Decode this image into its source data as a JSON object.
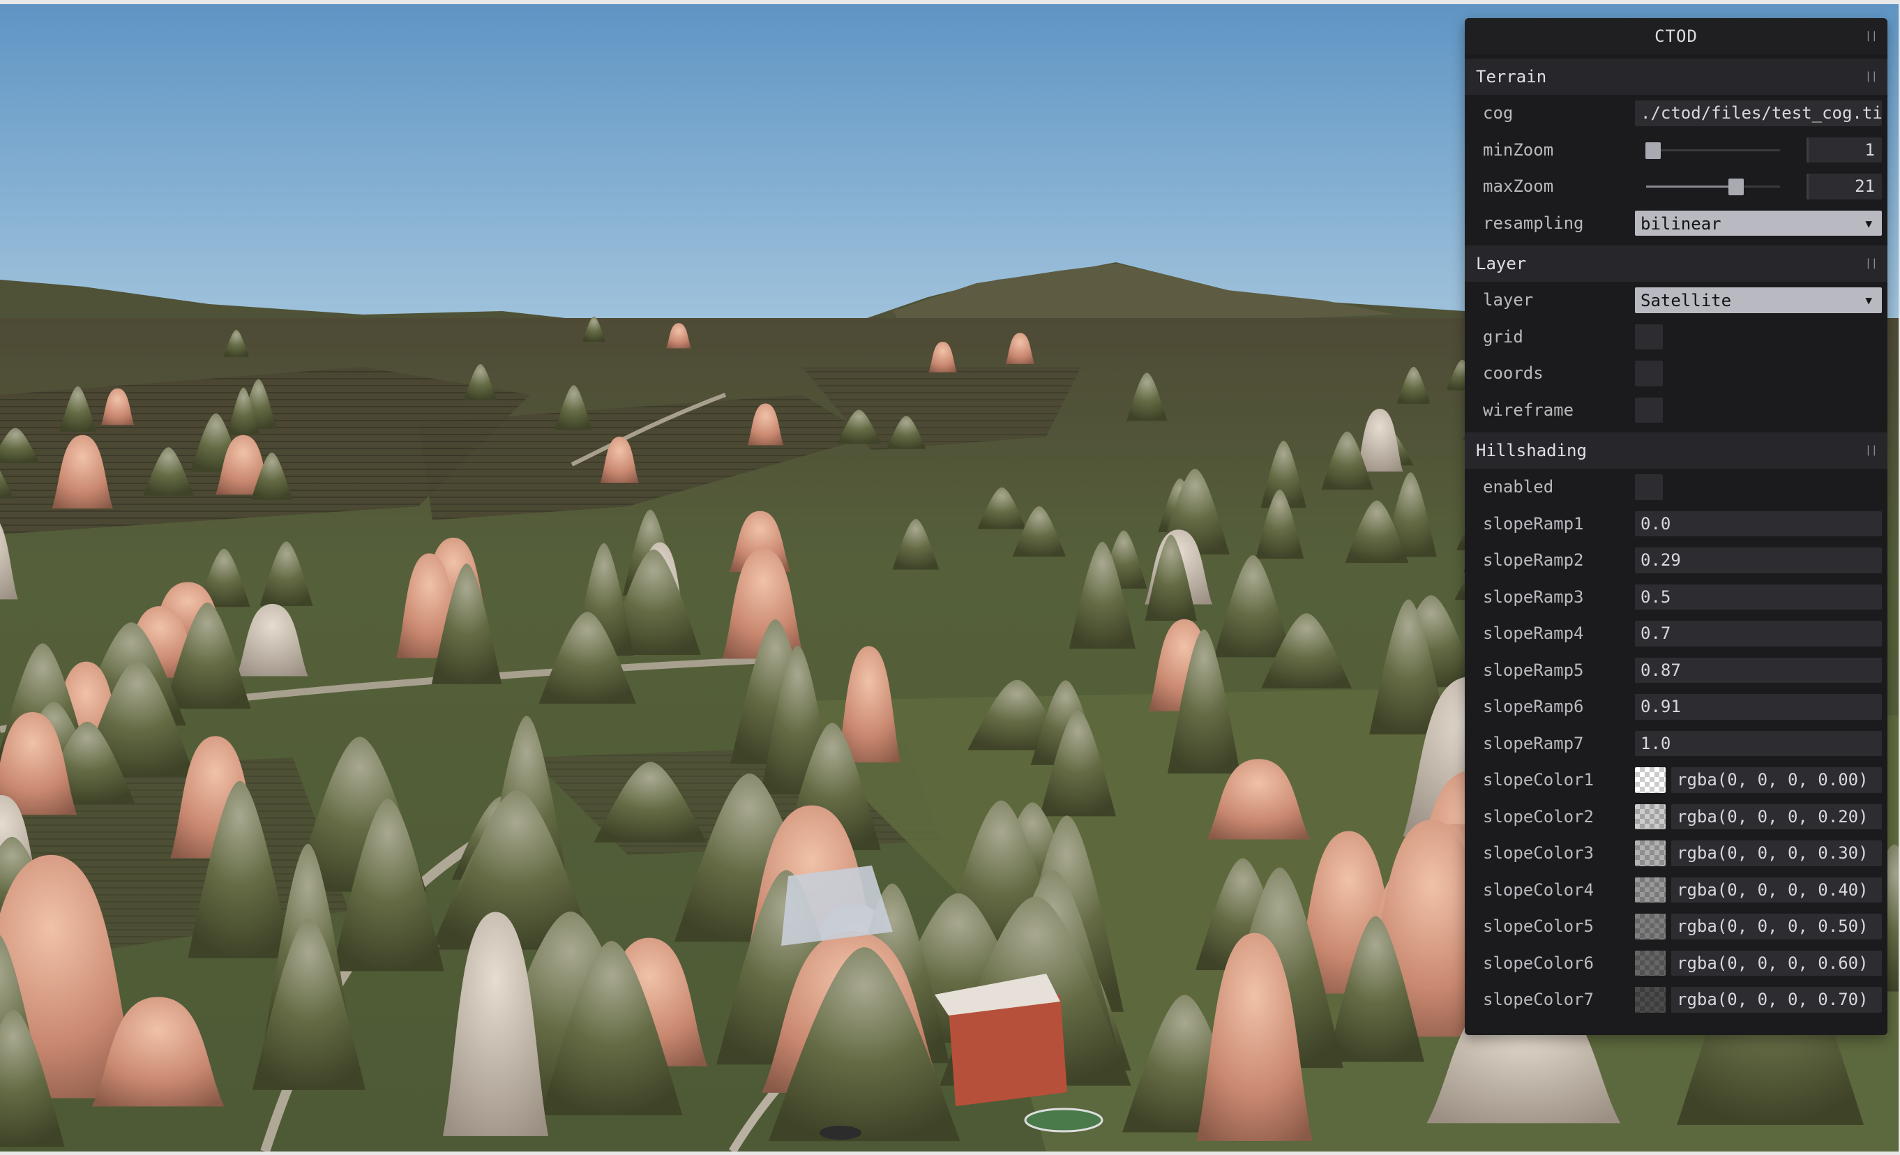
{
  "panel": {
    "title": "CTOD",
    "terrain": {
      "title": "Terrain",
      "cog_label": "cog",
      "cog_value": "./ctod/files/test_cog.tif",
      "minzoom_label": "minZoom",
      "minzoom_value": "1",
      "minzoom_level": 0.05,
      "maxzoom_label": "maxZoom",
      "maxzoom_value": "21",
      "maxzoom_level": 0.67,
      "resampling_label": "resampling",
      "resampling_value": "bilinear"
    },
    "layer": {
      "title": "Layer",
      "layer_label": "layer",
      "layer_value": "Satellite",
      "grid_label": "grid",
      "coords_label": "coords",
      "wireframe_label": "wireframe"
    },
    "hillshading": {
      "title": "Hillshading",
      "enabled_label": "enabled",
      "ramps": [
        {
          "label": "slopeRamp1",
          "value": "0.0"
        },
        {
          "label": "slopeRamp2",
          "value": "0.29"
        },
        {
          "label": "slopeRamp3",
          "value": "0.5"
        },
        {
          "label": "slopeRamp4",
          "value": "0.7"
        },
        {
          "label": "slopeRamp5",
          "value": "0.87"
        },
        {
          "label": "slopeRamp6",
          "value": "0.91"
        },
        {
          "label": "slopeRamp7",
          "value": "1.0"
        }
      ],
      "colors": [
        {
          "label": "slopeColor1",
          "value": "rgba(0, 0, 0, 0.00)",
          "alpha": 0.0
        },
        {
          "label": "slopeColor2",
          "value": "rgba(0, 0, 0, 0.20)",
          "alpha": 0.2
        },
        {
          "label": "slopeColor3",
          "value": "rgba(0, 0, 0, 0.30)",
          "alpha": 0.3
        },
        {
          "label": "slopeColor4",
          "value": "rgba(0, 0, 0, 0.40)",
          "alpha": 0.4
        },
        {
          "label": "slopeColor5",
          "value": "rgba(0, 0, 0, 0.50)",
          "alpha": 0.5
        },
        {
          "label": "slopeColor6",
          "value": "rgba(0, 0, 0, 0.60)",
          "alpha": 0.6
        },
        {
          "label": "slopeColor7",
          "value": "rgba(0, 0, 0, 0.70)",
          "alpha": 0.7
        }
      ]
    }
  },
  "icons": {
    "collapse": "collapse-icon",
    "dropdown": "chevron-down-icon"
  },
  "colors": {
    "sky_top": "#5f95c4",
    "sky_horizon": "#a9c9df",
    "terrain_green": "#55603a",
    "roof": "#c98870",
    "panel_bg": "#1b1b1d"
  }
}
